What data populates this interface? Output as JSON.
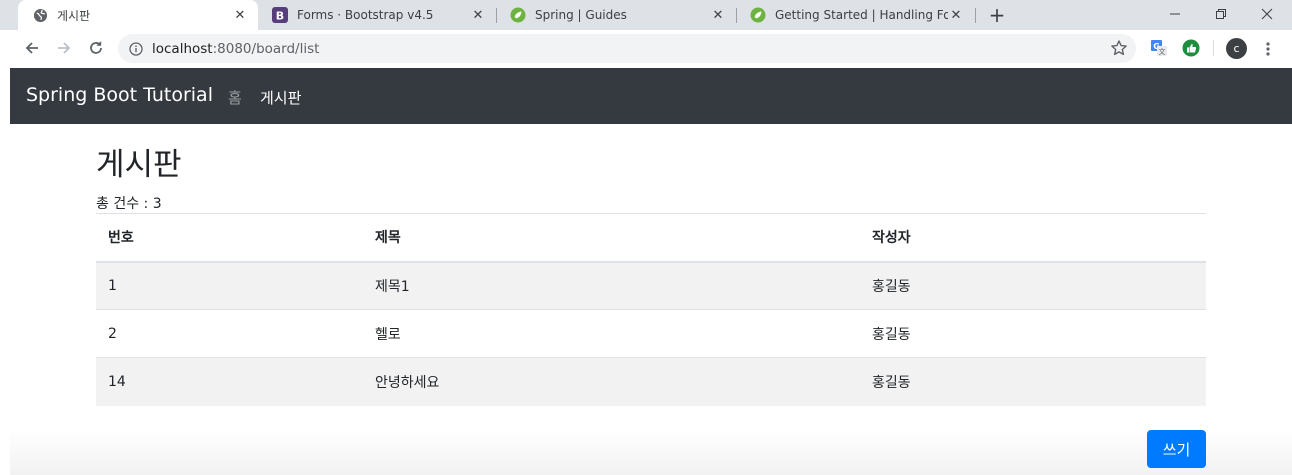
{
  "browser": {
    "tabs": [
      {
        "title": "게시판",
        "favicon": "globe-icon",
        "active": true
      },
      {
        "title": "Forms · Bootstrap v4.5",
        "favicon": "bootstrap-icon",
        "active": false
      },
      {
        "title": "Spring | Guides",
        "favicon": "spring-leaf-icon",
        "active": false
      },
      {
        "title": "Getting Started | Handling Form",
        "favicon": "spring-leaf-icon",
        "active": false
      }
    ],
    "url": {
      "host": "localhost",
      "path": ":8080/board/list"
    },
    "profile_initial": "c",
    "colors": {
      "tabstrip": "#dee1e6",
      "omnibox": "#f1f3f4"
    }
  },
  "navbar": {
    "brand": "Spring Boot Tutorial",
    "links": [
      {
        "label": "홈",
        "active": false
      },
      {
        "label": "게시판",
        "active": true
      }
    ],
    "colors": {
      "background": "#343a40"
    }
  },
  "main": {
    "heading": "게시판",
    "total_count": "총 건수 : 3",
    "table": {
      "headers": [
        "번호",
        "제목",
        "작성자"
      ],
      "rows": [
        [
          "1",
          "제목1",
          "홍길동"
        ],
        [
          "2",
          "헬로",
          "홍길동"
        ],
        [
          "14",
          "안녕하세요",
          "홍길동"
        ]
      ]
    },
    "write_button": "쓰기",
    "colors": {
      "primary": "#007bff"
    }
  }
}
